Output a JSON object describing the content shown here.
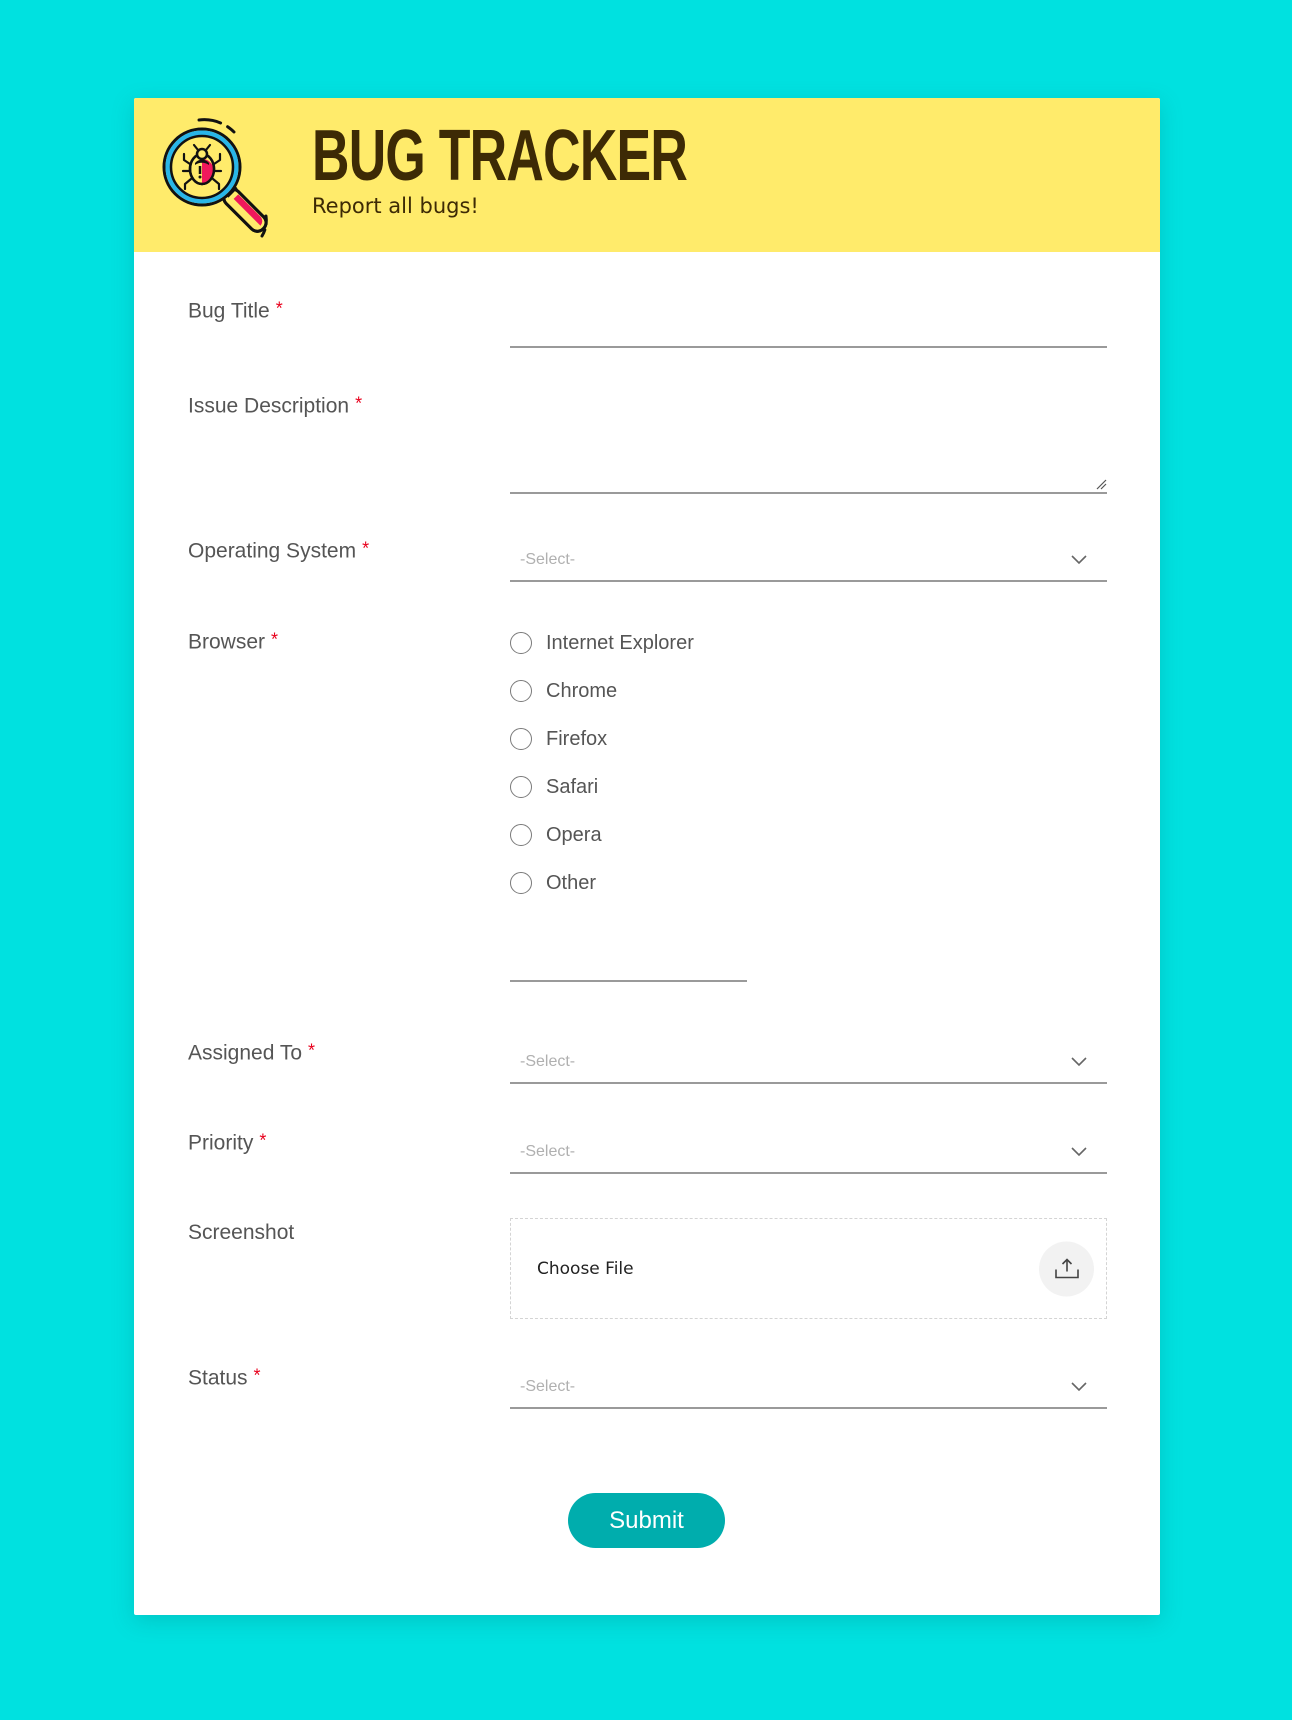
{
  "header": {
    "title": "BUG TRACKER",
    "subtitle": "Report all bugs!",
    "logo_icon": "magnifier-bug-icon",
    "background_color": "#FFEB6B",
    "text_color": "#3D2A05"
  },
  "page": {
    "background_color": "#00E1E0"
  },
  "form": {
    "required_marker": "*",
    "fields": {
      "bug_title": {
        "label": "Bug Title",
        "required": true,
        "value": "",
        "placeholder": ""
      },
      "issue_description": {
        "label": "Issue Description",
        "required": true,
        "value": "",
        "placeholder": ""
      },
      "operating_system": {
        "label": "Operating System",
        "required": true,
        "placeholder": "-Select-"
      },
      "browser": {
        "label": "Browser",
        "required": true,
        "options": [
          "Internet Explorer",
          "Chrome",
          "Firefox",
          "Safari",
          "Opera",
          "Other"
        ],
        "selected": null,
        "other_value": ""
      },
      "assigned_to": {
        "label": "Assigned To",
        "required": true,
        "placeholder": "-Select-"
      },
      "priority": {
        "label": "Priority",
        "required": true,
        "placeholder": "-Select-"
      },
      "screenshot": {
        "label": "Screenshot",
        "required": false,
        "button_label": "Choose File",
        "icon": "upload-icon"
      },
      "status": {
        "label": "Status",
        "required": true,
        "placeholder": "-Select-"
      }
    },
    "submit_label": "Submit",
    "accent_color": "#00ADAD",
    "required_color": "#E8001C"
  }
}
